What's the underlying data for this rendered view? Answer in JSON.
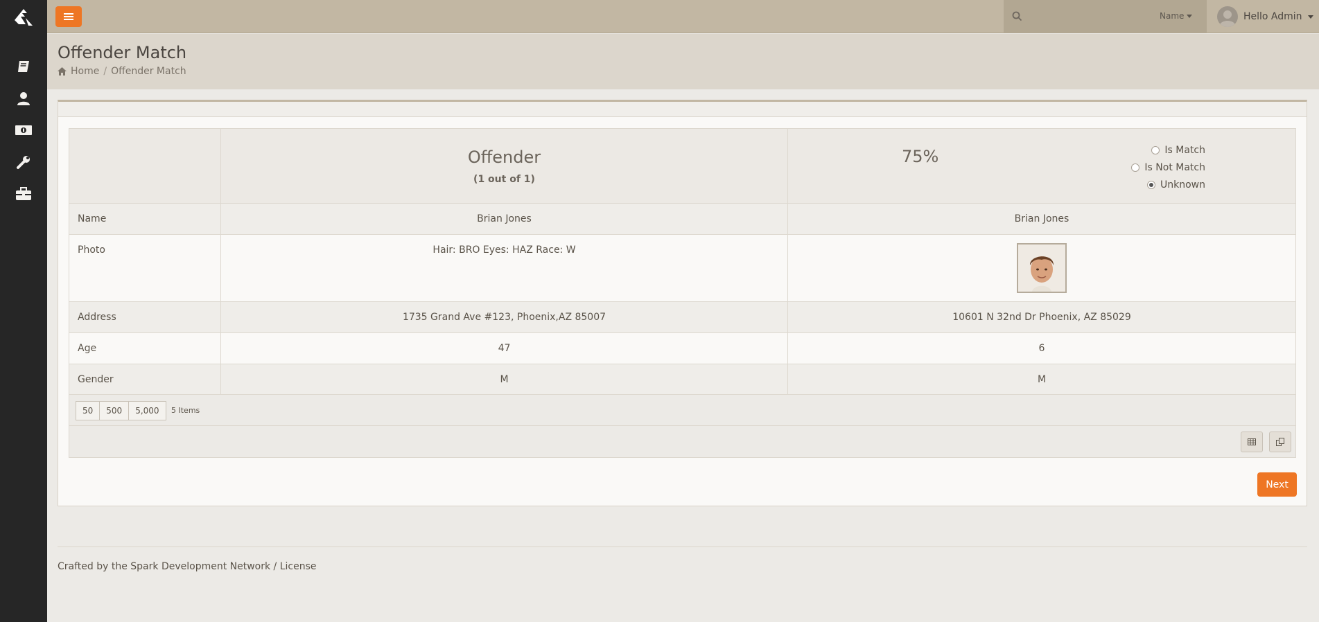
{
  "header": {
    "search_placeholder": "",
    "search_filter": "Name",
    "user_greeting": "Hello Admin"
  },
  "page": {
    "title": "Offender Match",
    "breadcrumb": [
      "Home",
      "Offender Match"
    ]
  },
  "sidebar": {
    "icons": [
      "book-icon",
      "user-icon",
      "money-icon",
      "wrench-icon",
      "briefcase-icon"
    ]
  },
  "grid": {
    "header": {
      "offender_title": "Offender",
      "offender_sub": "(1 out of 1)",
      "match_percent": "75%",
      "options": [
        "Is Match",
        "Is Not Match",
        "Unknown"
      ],
      "selected": "Unknown"
    },
    "rows": [
      {
        "label": "Name",
        "offender": "Brian Jones",
        "candidate": "Brian Jones"
      },
      {
        "label": "Photo",
        "offender": "Hair: BRO Eyes: HAZ Race: W",
        "candidate": ""
      },
      {
        "label": "Address",
        "offender": "1735 Grand Ave #123, Phoenix,AZ 85007",
        "candidate": "10601 N 32nd Dr Phoenix, AZ 85029"
      },
      {
        "label": "Age",
        "offender": "47",
        "candidate": "6"
      },
      {
        "label": "Gender",
        "offender": "M",
        "candidate": "M"
      }
    ],
    "page_sizes": [
      "50",
      "500",
      "5,000"
    ],
    "item_count": "5 Items"
  },
  "actions": {
    "next_label": "Next"
  },
  "footer": {
    "text": "Crafted by the Spark Development Network / License"
  },
  "colors": {
    "accent": "#ee7624",
    "sidebar": "#262626",
    "topbar": "#c2b7a3"
  }
}
